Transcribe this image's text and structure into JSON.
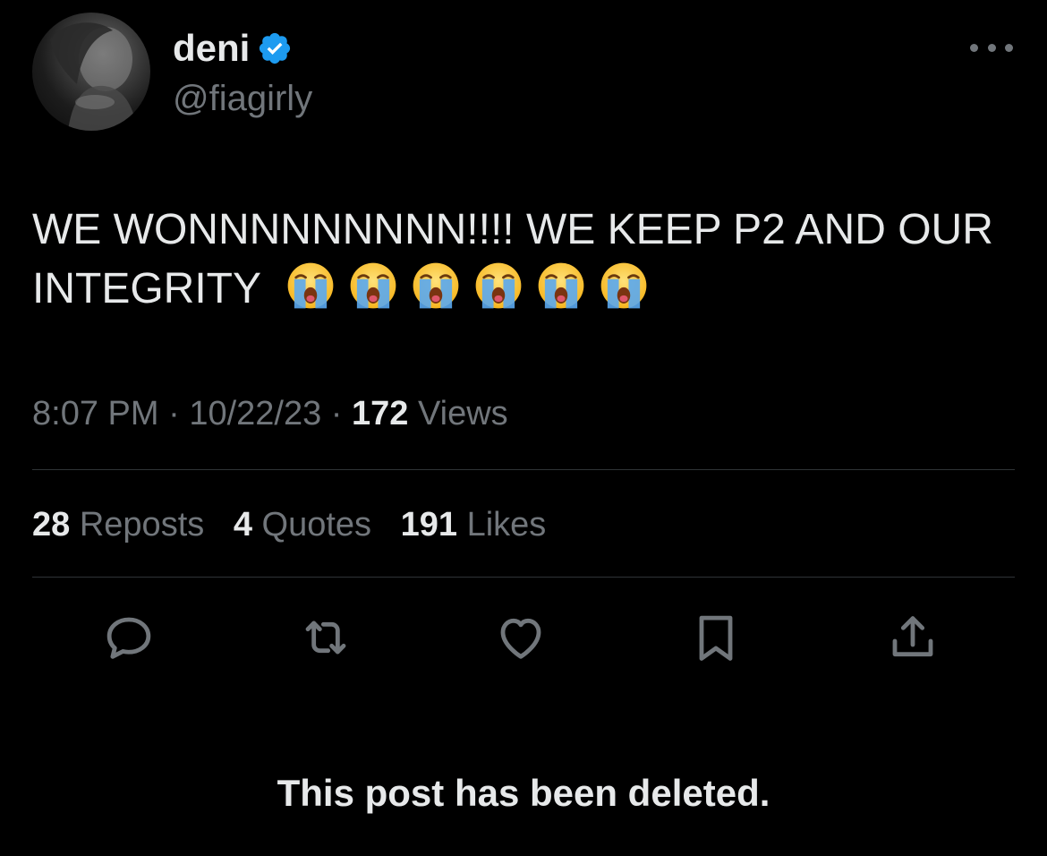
{
  "author": {
    "display_name": "deni",
    "handle": "@fiagirly",
    "verified_icon": "verified-badge-icon",
    "accent_color": "#1d9bf0"
  },
  "post": {
    "text": "WE WONNNNNNNNN!!!! WE KEEP P2 AND OUR INTEGRITY",
    "emoji_name": "loudly-crying-face",
    "emoji_count": 6,
    "time": "8:07 PM",
    "date": "10/22/23",
    "views_count": "172",
    "views_label": "Views",
    "separator": "·"
  },
  "stats": {
    "reposts_count": "28",
    "reposts_label": "Reposts",
    "quotes_count": "4",
    "quotes_label": "Quotes",
    "likes_count": "191",
    "likes_label": "Likes"
  },
  "actions": [
    "reply-icon",
    "repost-icon",
    "like-icon",
    "bookmark-icon",
    "share-icon"
  ],
  "notice": "This post has been deleted.",
  "colors": {
    "background": "#000000",
    "primary_text": "#e7e9ea",
    "secondary_text": "#71767b",
    "divider": "#2f3336"
  }
}
